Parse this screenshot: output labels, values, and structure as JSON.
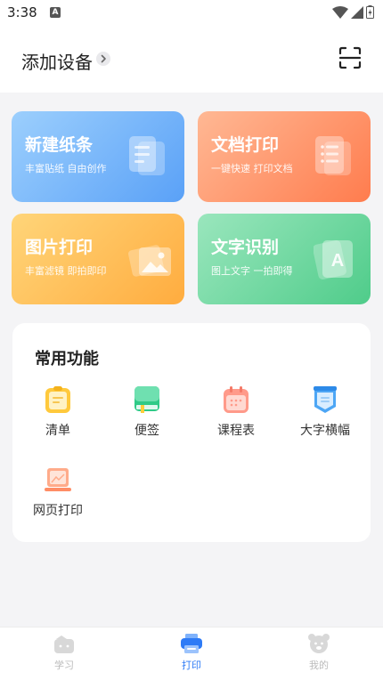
{
  "status_bar": {
    "time": "3:38",
    "notification_letter": "A"
  },
  "header": {
    "title": "添加设备"
  },
  "cards": [
    {
      "title": "新建纸条",
      "subtitle": "丰富贴纸 自由创作"
    },
    {
      "title": "文档打印",
      "subtitle": "一键快速 打印文档"
    },
    {
      "title": "图片打印",
      "subtitle": "丰富滤镜 即拍即印"
    },
    {
      "title": "文字识别",
      "subtitle": "图上文字 一拍即得",
      "icon_letter": "A"
    }
  ],
  "functions": {
    "title": "常用功能",
    "items": [
      {
        "label": "清单"
      },
      {
        "label": "便签"
      },
      {
        "label": "课程表"
      },
      {
        "label": "大字横幅"
      },
      {
        "label": "网页打印"
      }
    ]
  },
  "tabbar": {
    "tabs": [
      {
        "label": "学习"
      },
      {
        "label": "打印"
      },
      {
        "label": "我的"
      }
    ],
    "active_index": 1,
    "active_color": "#2e7bf6"
  }
}
